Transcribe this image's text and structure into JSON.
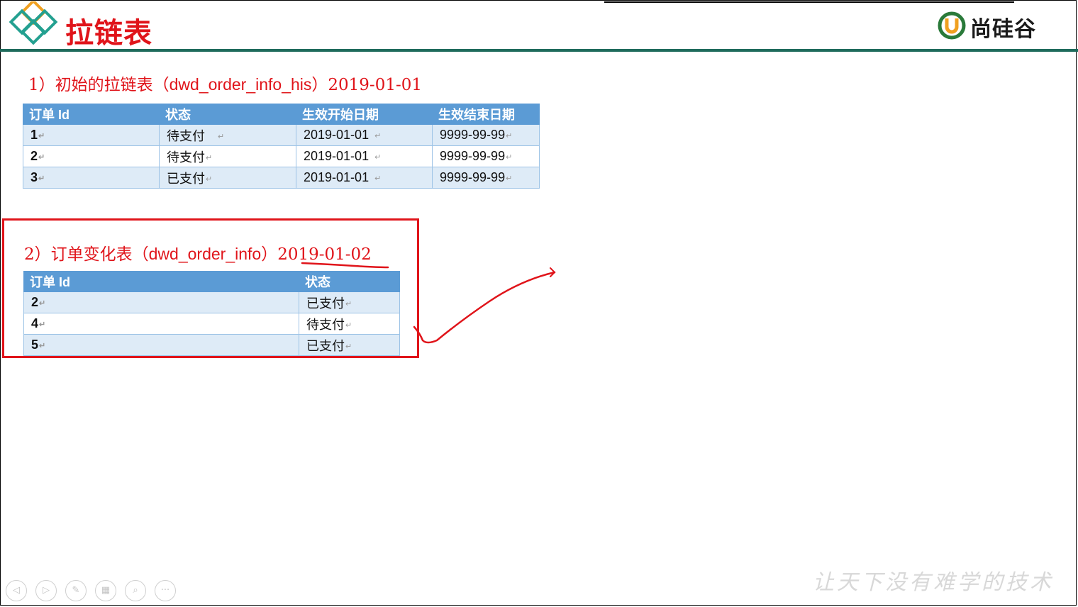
{
  "slide": {
    "title": "拉链表",
    "brand": "尚硅谷",
    "slogan": "让天下没有难学的技术"
  },
  "section1": {
    "heading_prefix": "1）初始的拉链表（",
    "heading_table": "dwd_order_info_his",
    "heading_suffix": "）2019-01-01",
    "columns": [
      "订单 Id",
      "状态",
      "生效开始日期",
      "生效结束日期"
    ],
    "rows": [
      [
        "1",
        "待支付",
        "2019-01-01",
        "9999-99-99"
      ],
      [
        "2",
        "待支付",
        "2019-01-01",
        "9999-99-99"
      ],
      [
        "3",
        "已支付",
        "2019-01-01",
        "9999-99-99"
      ]
    ]
  },
  "section2": {
    "heading_prefix": "2）订单变化表（",
    "heading_table": "dwd_order_info",
    "heading_suffix": "）",
    "heading_date": "2019-01-02",
    "columns": [
      "订单 Id",
      "状态"
    ],
    "rows": [
      [
        "2",
        "已支付"
      ],
      [
        "4",
        "待支付"
      ],
      [
        "5",
        "已支付"
      ]
    ],
    "row_colors": [
      "#e0141a",
      "#1a9641",
      "#1a9641"
    ]
  },
  "controls": [
    "prev-icon",
    "next-icon",
    "pen-icon",
    "slides-icon",
    "zoom-icon",
    "more-icon"
  ],
  "colors": {
    "accent_red": "#e0141a",
    "header_blue": "#5b9bd5",
    "band_blue": "#deebf7",
    "rule_green": "#1f6b5c",
    "changed_green": "#1a9641"
  }
}
